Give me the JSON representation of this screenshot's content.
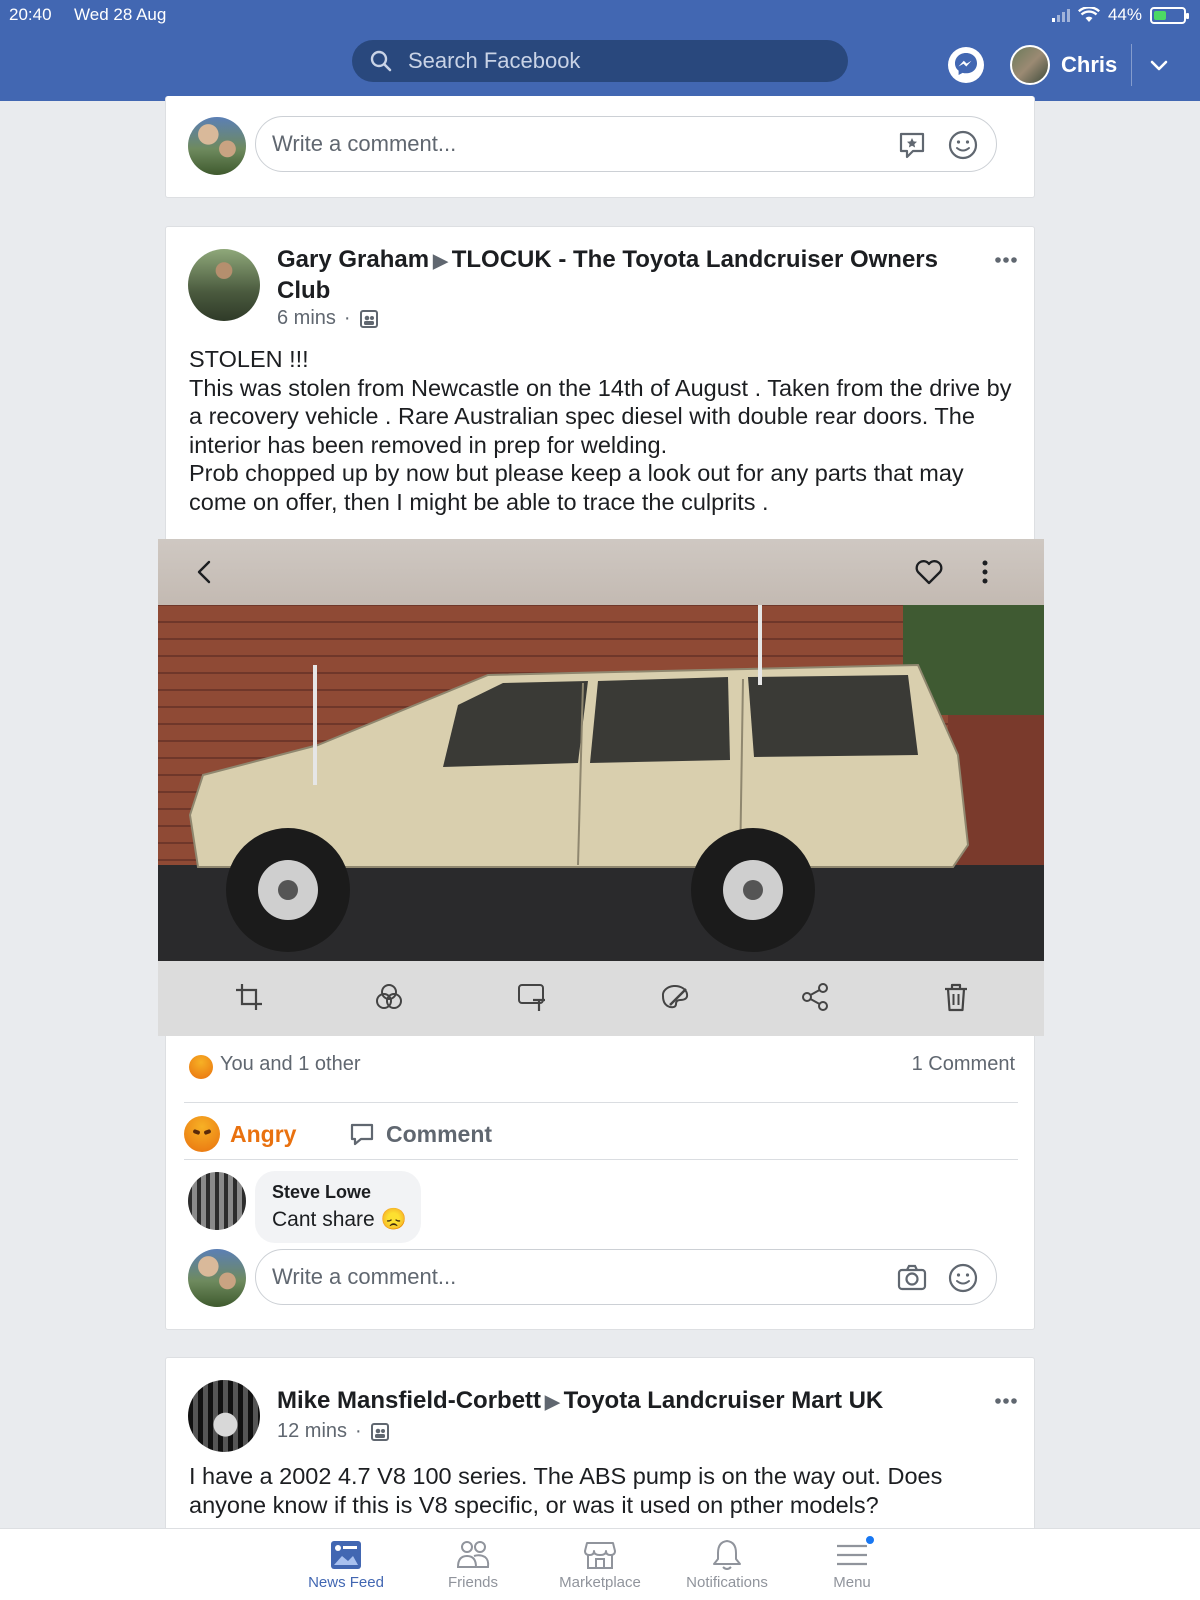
{
  "status_bar": {
    "time": "20:40",
    "date": "Wed 28 Aug",
    "battery": "44%",
    "battery_level": 0.44
  },
  "header": {
    "search_placeholder": "Search Facebook",
    "user_name": "Chris"
  },
  "comment_box": {
    "placeholder": "Write a comment..."
  },
  "post1": {
    "author": "Gary Graham",
    "group": "TLOCUK - The Toyota Landcruiser Owners Club",
    "time": "6 mins",
    "text": "STOLEN !!!\nThis was stolen from Newcastle on the 14th of August . Taken from the drive by a recovery vehicle . Rare Australian spec diesel with double rear doors. The interior has been removed in prep for welding.\nProb chopped up by now but please keep a look out for any parts that may come on offer, then I might be able to trace the culprits .",
    "reactions_summary": "You and 1 other",
    "comment_count": "1 Comment",
    "actions": {
      "reaction": "Angry",
      "comment": "Comment"
    },
    "comments": [
      {
        "author": "Steve Lowe",
        "text": "Cant share 😞"
      }
    ]
  },
  "post2": {
    "author": "Mike Mansfield-Corbett",
    "group": "Toyota Landcruiser Mart UK",
    "time": "12 mins",
    "text": "I have a 2002 4.7 V8 100 series. The ABS pump is on the way out. Does anyone know if this is V8 specific, or was it used on pther models?"
  },
  "bottom_nav": [
    {
      "label": "News Feed",
      "icon": "news-feed-icon",
      "active": true
    },
    {
      "label": "Friends",
      "icon": "friends-icon"
    },
    {
      "label": "Marketplace",
      "icon": "marketplace-icon"
    },
    {
      "label": "Notifications",
      "icon": "notifications-icon"
    },
    {
      "label": "Menu",
      "icon": "menu-icon"
    }
  ],
  "colors": {
    "brand": "#4267b2",
    "angry": "#e9710f",
    "text": "#1c1e21",
    "secondary": "#606770"
  }
}
